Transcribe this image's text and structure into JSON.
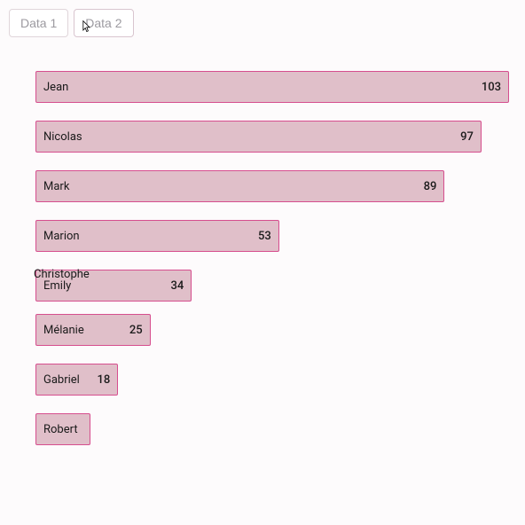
{
  "tabs": [
    {
      "label": "Data 1",
      "active": false
    },
    {
      "label": "Data 2",
      "active": true
    }
  ],
  "extra_label": "Christophe",
  "chart_data": {
    "type": "bar",
    "orientation": "horizontal",
    "categories": [
      "Jean",
      "Nicolas",
      "Mark",
      "Marion",
      "Emily",
      "Mélanie",
      "Gabriel",
      "Robert"
    ],
    "values": [
      103,
      97,
      89,
      53,
      34,
      25,
      18,
      12
    ],
    "title": "",
    "xlabel": "",
    "ylabel": "",
    "xlim": [
      0,
      103
    ],
    "legend": false,
    "barColor": "#e0bfc9",
    "barBorder": "#d64e8e"
  }
}
